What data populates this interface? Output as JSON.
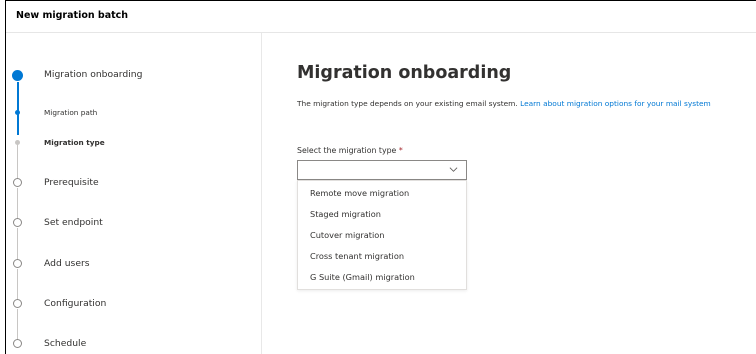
{
  "window": {
    "title": "New migration batch"
  },
  "steps": [
    {
      "label": "Migration onboarding",
      "state": "active"
    },
    {
      "label": "Migration path",
      "state": "sub-complete"
    },
    {
      "label": "Migration type",
      "state": "sub-current"
    },
    {
      "label": "Prerequisite",
      "state": "pending"
    },
    {
      "label": "Set endpoint",
      "state": "pending"
    },
    {
      "label": "Add users",
      "state": "pending"
    },
    {
      "label": "Configuration",
      "state": "pending"
    },
    {
      "label": "Schedule",
      "state": "pending"
    }
  ],
  "main": {
    "title": "Migration onboarding",
    "description": "The migration type depends on your existing email system. ",
    "link": "Learn about migration options for your mail system",
    "field_label": "Select the migration type",
    "required_marker": "*",
    "selected_value": "",
    "options": [
      "Remote move migration",
      "Staged migration",
      "Cutover migration",
      "Cross tenant migration",
      "G Suite (Gmail) migration"
    ]
  },
  "colors": {
    "accent": "#0078d4",
    "required": "#a4262c",
    "text": "#323130"
  }
}
